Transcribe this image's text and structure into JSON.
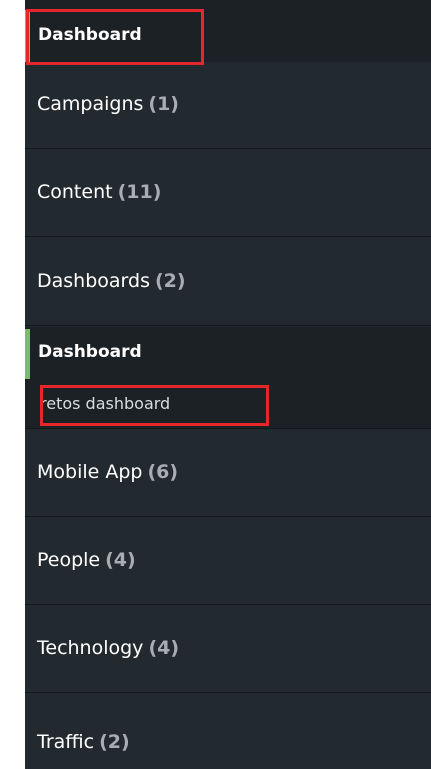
{
  "colors": {
    "sidebar_bg": "#232a2f",
    "subitem_bg": "#1c2126",
    "active_accent": "#7cba6f",
    "highlight": "#e3272b",
    "count_text": "#a7adb0"
  },
  "top_section": {
    "label": "Dashboard"
  },
  "menu": [
    {
      "label": "Campaigns",
      "count": "(1)"
    },
    {
      "label": "Content",
      "count": "(11)"
    },
    {
      "label": "Dashboards",
      "count": "(2)"
    },
    {
      "label": "Mobile App",
      "count": "(6)"
    },
    {
      "label": "People",
      "count": "(4)"
    },
    {
      "label": "Technology",
      "count": "(4)"
    },
    {
      "label": "Traffic",
      "count": "(2)"
    }
  ],
  "dashboards_submenu": {
    "section_label": "Dashboard",
    "items": [
      {
        "label": "retos dashboard"
      }
    ]
  }
}
